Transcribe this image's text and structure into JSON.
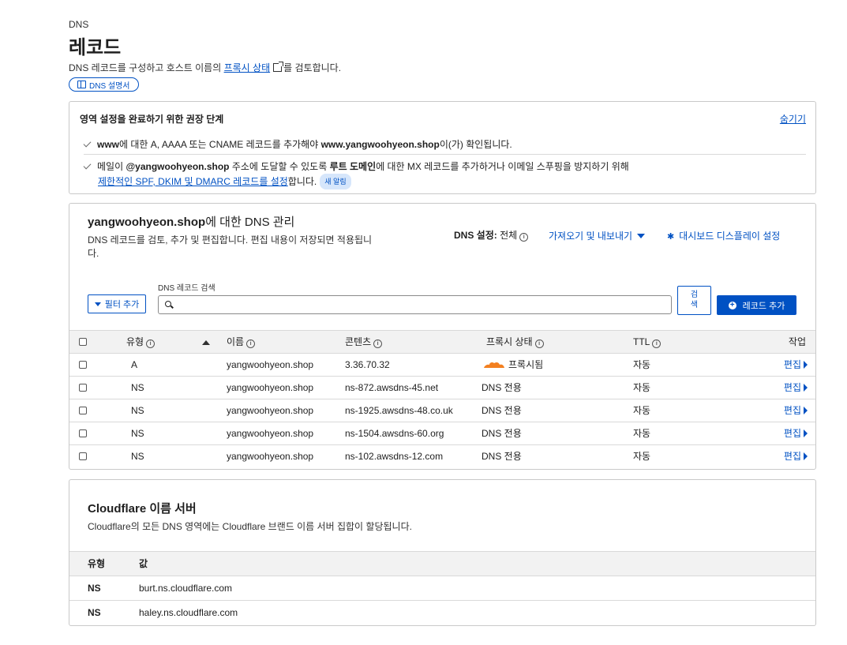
{
  "header": {
    "eyebrow": "DNS",
    "title": "레코드",
    "desc_before": "DNS 레코드를 구성하고 호스트 이름의 ",
    "desc_link": "프록시 상태",
    "desc_after": "를 검토합니다.",
    "docs_pill": "DNS 설명서"
  },
  "recommend": {
    "title": "영역 설정을 완료하기 위한 권장 단계",
    "hide_label": "숨기기",
    "item1": {
      "bold1": "www",
      "text1": "에 대한 A, AAAA 또는 CNAME 레코드를 추가해야 ",
      "bold2": "www.yangwoohyeon.shop",
      "text2": "이(가) 확인됩니다."
    },
    "item2": {
      "text1": "메일이 ",
      "bold1": "@yangwoohyeon.shop",
      "text2": " 주소에 도달할 수 있도록 ",
      "bold2": "루트 도메인",
      "text3": "에 대한 MX 레코드를 추가하거나 이메일 스푸핑을 방지하기 위해",
      "link": "제한적인 SPF, DKIM 및 DMARC 레코드를 설정",
      "text4": "합니다.",
      "badge": "새 알림"
    }
  },
  "dns": {
    "title_bold": "yangwoohyeon.shop",
    "title_rest": "에 대한 DNS 관리",
    "desc": "DNS 레코드를 검토, 추가 및 편집합니다. 편집 내용이 저장되면 적용됩니다.",
    "setting_label": "DNS 설정:",
    "setting_value": "전체",
    "import_export": "가져오기 및 내보내기",
    "dashboard_settings": "대시보드 디스플레이 설정",
    "search_label": "DNS 레코드 검색",
    "filter_btn": "필터 추가",
    "search_placeholder": "",
    "search_btn_1": "검",
    "search_btn_2": "색",
    "add_btn": "레코드 추가",
    "columns": {
      "type": "유형",
      "name": "이름",
      "content": "콘텐츠",
      "proxy": "프록시 상태",
      "ttl": "TTL",
      "action": "작업"
    },
    "rows": [
      {
        "type": "A",
        "name": "yangwoohyeon.shop",
        "content": "3.36.70.32",
        "proxy": "프록시됨",
        "ttl": "자동",
        "action": "편집"
      },
      {
        "type": "NS",
        "name": "yangwoohyeon.shop",
        "content": "ns-872.awsdns-45.net",
        "proxy": "DNS 전용",
        "ttl": "자동",
        "action": "편집"
      },
      {
        "type": "NS",
        "name": "yangwoohyeon.shop",
        "content": "ns-1925.awsdns-48.co.uk",
        "proxy": "DNS 전용",
        "ttl": "자동",
        "action": "편집"
      },
      {
        "type": "NS",
        "name": "yangwoohyeon.shop",
        "content": "ns-1504.awsdns-60.org",
        "proxy": "DNS 전용",
        "ttl": "자동",
        "action": "편집"
      },
      {
        "type": "NS",
        "name": "yangwoohyeon.shop",
        "content": "ns-102.awsdns-12.com",
        "proxy": "DNS 전용",
        "ttl": "자동",
        "action": "편집"
      }
    ],
    "proxied_color": "#f38020",
    "accent_color": "#0051c3"
  },
  "nameservers": {
    "title": "Cloudflare 이름 서버",
    "desc": "Cloudflare의 모든 DNS 영역에는 Cloudflare 브랜드 이름 서버 집합이 할당됩니다.",
    "col_type": "유형",
    "col_value": "값",
    "rows": [
      {
        "type": "NS",
        "value": "burt.ns.cloudflare.com"
      },
      {
        "type": "NS",
        "value": "haley.ns.cloudflare.com"
      }
    ]
  }
}
